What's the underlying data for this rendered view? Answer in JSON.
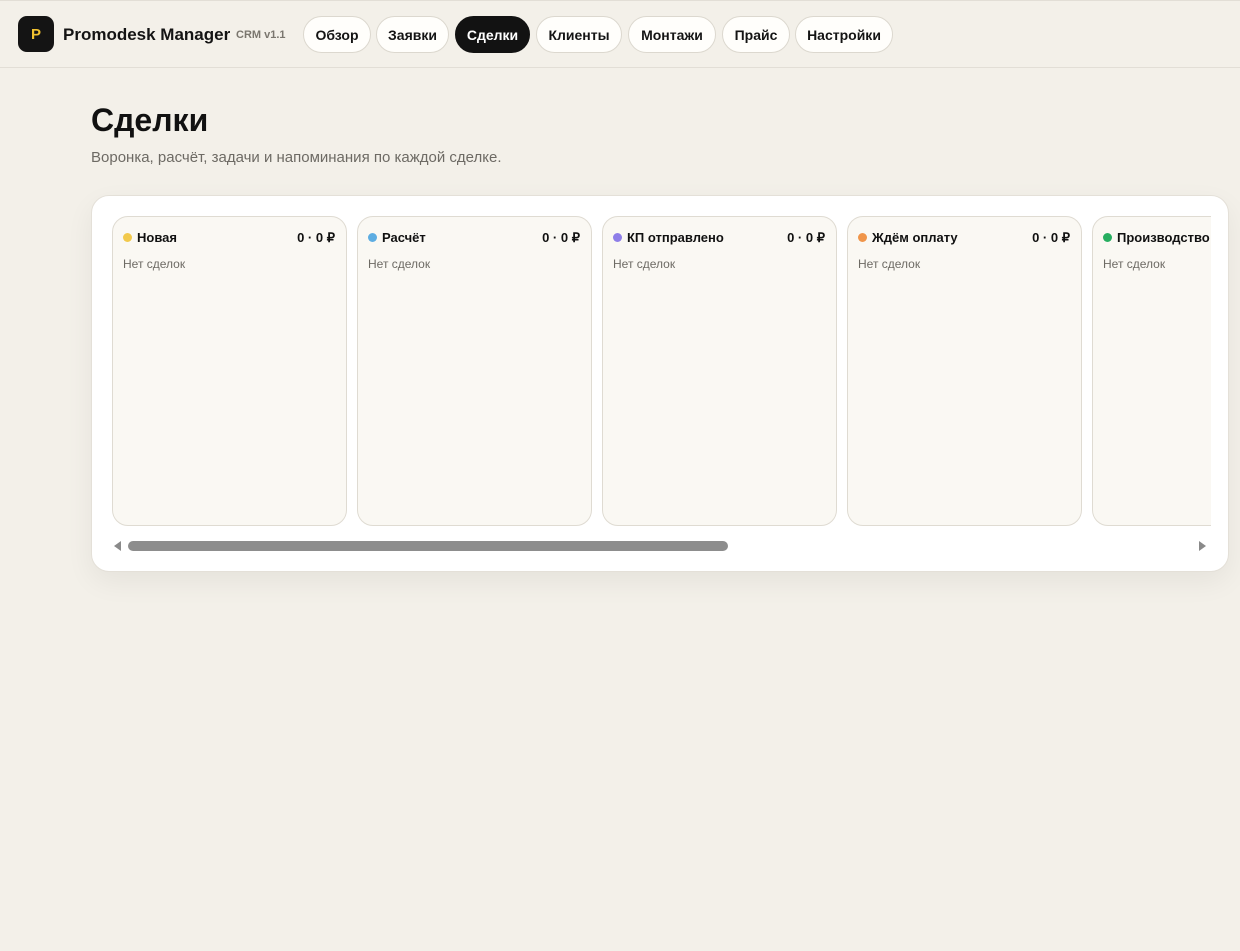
{
  "header": {
    "logo_letter": "P",
    "app_name": "Promodesk Manager",
    "version": "CRM v1.1",
    "tabs": [
      {
        "label": "Обзор",
        "active": false
      },
      {
        "label": "Заявки",
        "active": false
      },
      {
        "label": "Сделки",
        "active": true
      },
      {
        "label": "Клиенты",
        "active": false
      },
      {
        "label": "Монтажи",
        "active": false
      },
      {
        "label": "Прайс",
        "active": false
      },
      {
        "label": "Настройки",
        "active": false
      }
    ]
  },
  "page": {
    "title": "Сделки",
    "subtitle": "Воронка, расчёт, задачи и напоминания по каждой сделке."
  },
  "board": {
    "columns": [
      {
        "title": "Новая",
        "summary": "0 · 0 ₽",
        "empty_text": "Нет сделок",
        "color": "#f2c94c"
      },
      {
        "title": "Расчёт",
        "summary": "0 · 0 ₽",
        "empty_text": "Нет сделок",
        "color": "#5dade2"
      },
      {
        "title": "КП отправлено",
        "summary": "0 · 0 ₽",
        "empty_text": "Нет сделок",
        "color": "#8e7ee8"
      },
      {
        "title": "Ждём оплату",
        "summary": "0 · 0 ₽",
        "empty_text": "Нет сделок",
        "color": "#f0954a"
      },
      {
        "title": "Производство",
        "summary": "",
        "empty_text": "Нет сделок",
        "color": "#27ae60"
      }
    ]
  },
  "colors": {
    "background": "#f3f0e9",
    "accent_dark": "#121212",
    "logo_accent": "#f2c230"
  }
}
